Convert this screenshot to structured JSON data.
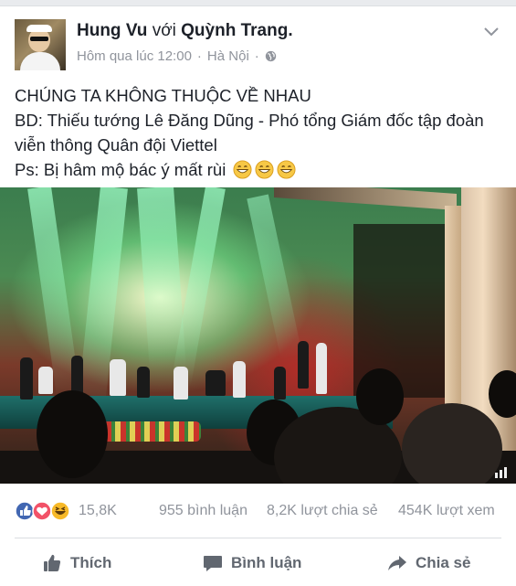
{
  "post": {
    "author": "Hung Vu",
    "with_word": "với",
    "tagged": "Quỳnh Trang.",
    "time": "Hôm qua lúc 12:00",
    "sep": "·",
    "place": "Hà Nội",
    "sep2": "·",
    "lines": [
      "CHÚNG TA KHÔNG THUỘC VỀ NHAU",
      "BD: Thiếu tướng Lê Đăng Dũng - Phó tổng Giám đốc tập đoàn viễn thông Quân đội Viettel",
      "Ps: Bị hâm mộ bác ý mất rùi"
    ],
    "emoji": [
      "grinning-emoji",
      "grinning-emoji",
      "grinning-emoji"
    ]
  },
  "stats": {
    "reactions": "15,8K",
    "reaction_icons": [
      "like-icon",
      "love-icon",
      "haha-icon"
    ],
    "comments": "955 bình luận",
    "shares": "8,2K lượt chia sẻ",
    "views": "454K lượt xem"
  },
  "actions": {
    "like": "Thích",
    "comment": "Bình luận",
    "share": "Chia sẻ"
  },
  "colors": {
    "like_blue": "#4267b2",
    "love_red": "#f25268",
    "haha_yellow": "#f7b928",
    "muted_text": "#90949c",
    "action_text": "#616770"
  }
}
